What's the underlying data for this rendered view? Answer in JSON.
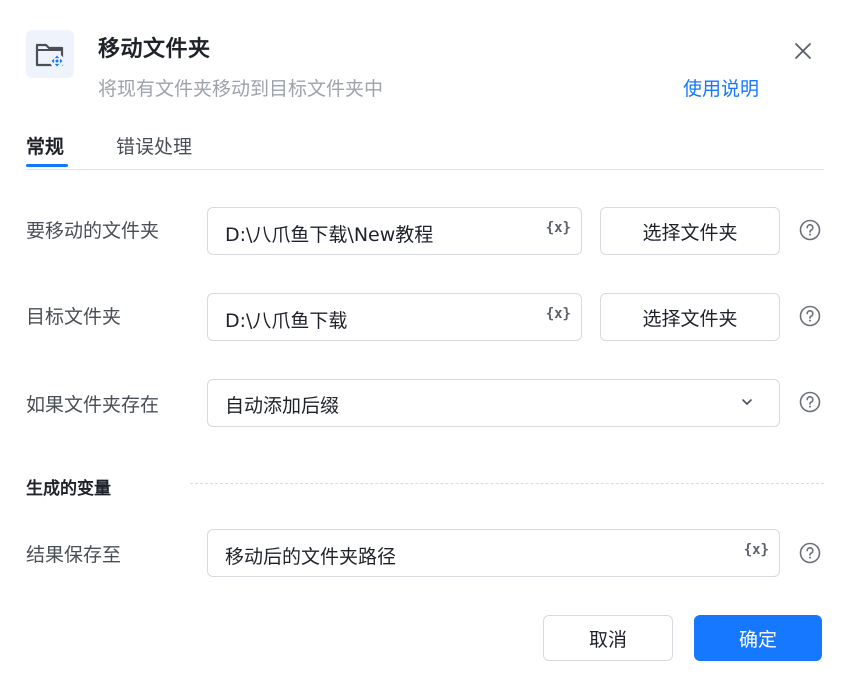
{
  "header": {
    "icon": "folder-move-icon",
    "title": "移动文件夹",
    "subtitle": "将现有文件夹移动到目标文件夹中",
    "help_link": "使用说明",
    "close_icon": "close-icon"
  },
  "tabs": [
    {
      "label": "常规",
      "active": true
    },
    {
      "label": "错误处理",
      "active": false
    }
  ],
  "form": {
    "source": {
      "label": "要移动的文件夹",
      "value": "D:\\八爪鱼下载\\New教程",
      "var_icon": "{x}",
      "button_label": "选择文件夹"
    },
    "target": {
      "label": "目标文件夹",
      "value": "D:\\八爪鱼下载",
      "var_icon": "{x}",
      "button_label": "选择文件夹"
    },
    "if_exists": {
      "label": "如果文件夹存在",
      "value": "自动添加后缀"
    }
  },
  "output_section": {
    "title": "生成的变量",
    "result": {
      "label": "结果保存至",
      "value": "移动后的文件夹路径",
      "var_icon": "{x}"
    }
  },
  "footer": {
    "cancel_label": "取消",
    "ok_label": "确定"
  },
  "colors": {
    "accent": "#1677ff",
    "text": "#1f2329",
    "muted": "#9ea3ab",
    "border": "#d7dade"
  }
}
